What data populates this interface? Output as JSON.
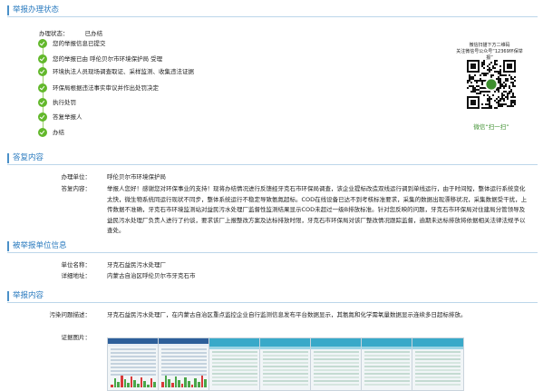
{
  "status_section": {
    "title": "举报办理状态",
    "status_label": "办理状态：",
    "status_value": "已办结",
    "steps": [
      "您的举报信息已提交",
      "您的举报已由 呼伦贝尔市环境保护局 受理",
      "环境执法人员现场调查取证、采样监测、收集违法证据",
      "环保局根据违法事实审议并作出处罚决定",
      "执行处罚",
      "答复举报人",
      "办结"
    ]
  },
  "qr": {
    "caption_line1": "微信扫描下方二维码",
    "caption_line2": "关注微信号公众号“12369环保举报”",
    "footer": "微信“扫一扫”"
  },
  "reply_section": {
    "title": "答复内容",
    "unit_label": "办理单位：",
    "unit_value": "呼伦贝尔市环境保护局",
    "content_label": "答复内容：",
    "content_value": "举报人您好！感谢您对环保事业的支持！现将办结情况进行反馈经牙克石市环保局调查，该企业提标改造双线运行调到单线运行，由于时间短，整体运行系统变化太快，微生物系统同运行现状不同步，整体系统运行不稳定导致氨氮超标。COD在线设备已达不到考核标准要求，采集的数据出现漂移状况，采集数据受干扰，上传数据不准确，牙克石市环境监测站对益民污水处理厂监督性监测结果显示COD未超过一级B排放标准。针对您反映的问题，牙克石市环保局对住建局分管领导及益民污水处理厂负责人进行了约谈，要求该厂上报整改方案及达标排放时限，牙克石市环保局对该厂整改情况跟踪监督，逾期未达标排放将依据相关法律法规予以查处。"
  },
  "reported_unit_section": {
    "title": "被举报单位信息",
    "name_label": "单位名称：",
    "name_value": "牙克石益民污水处理厂",
    "address_label": "详细地址：",
    "address_value": "内蒙古自治区呼伦贝尔市牙克石市"
  },
  "report_section": {
    "title": "举报内容",
    "desc_label": "污染问题描述：",
    "desc_value": "牙克石益民污水处理厂，在内蒙古自治区重点监控企业自行监测信息发布平台数据显示，其氨氮和化学需氧量数据显示连续多日超标排放。",
    "images_label": "证据图片：",
    "images": [
      "screenshot-1",
      "screenshot-2",
      "screenshot-3",
      "screenshot-4",
      "screenshot-5",
      "screenshot-6",
      "screenshot-7"
    ]
  },
  "colors": {
    "accent": "#2b7bbf",
    "step_green": "#62b82b",
    "section_rule": "#bcd6ea"
  }
}
